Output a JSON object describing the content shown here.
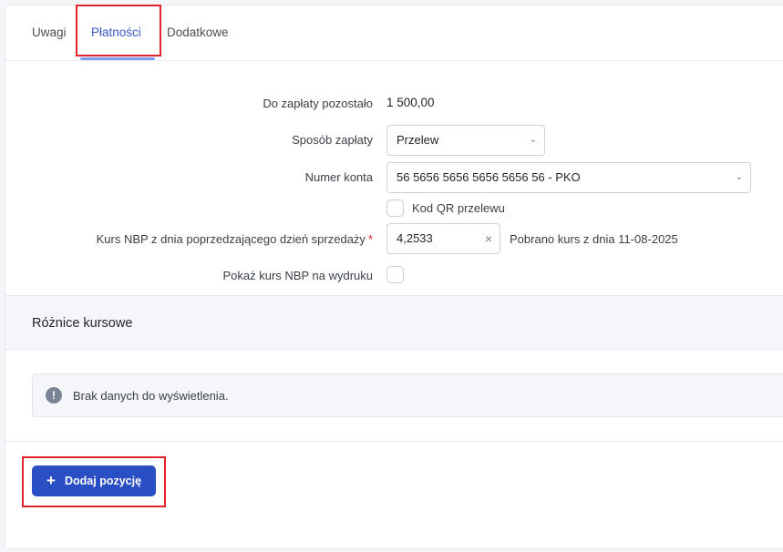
{
  "tabs": [
    {
      "label": "Uwagi"
    },
    {
      "label": "Płatności",
      "active": true
    },
    {
      "label": "Dodatkowe"
    }
  ],
  "form": {
    "remaining_label": "Do zapłaty pozostało",
    "remaining_value": "1 500,00",
    "payment_method_label": "Sposób zapłaty",
    "payment_method_value": "Przelew",
    "account_label": "Numer konta",
    "account_value": "56 5656 5656 5656 5656 56 - PKO",
    "qr_label": "Kod QR przelewu",
    "qr_checked": false,
    "rate_label": "Kurs NBP z dnia poprzedzającego dzień sprzedaży",
    "rate_required_mark": "*",
    "rate_value": "4,2533",
    "rate_info": "Pobrano kurs z dnia 11-08-2025",
    "show_rate_label": "Pokaż kurs NBP na wydruku",
    "show_rate_checked": false
  },
  "section": {
    "title": "Różnice kursowe",
    "empty_message": "Brak danych do wyświetlenia."
  },
  "actions": {
    "add_position_label": "Dodaj pozycję"
  },
  "icons": {
    "chevron": "chevron-down-icon",
    "clear": "clear-icon",
    "info": "info-icon",
    "plus": "plus-icon"
  },
  "colors": {
    "accent": "#2a4fc4",
    "active_tab": "#3a5bc7",
    "highlight": "#e0232f",
    "required": "#e0232f"
  }
}
